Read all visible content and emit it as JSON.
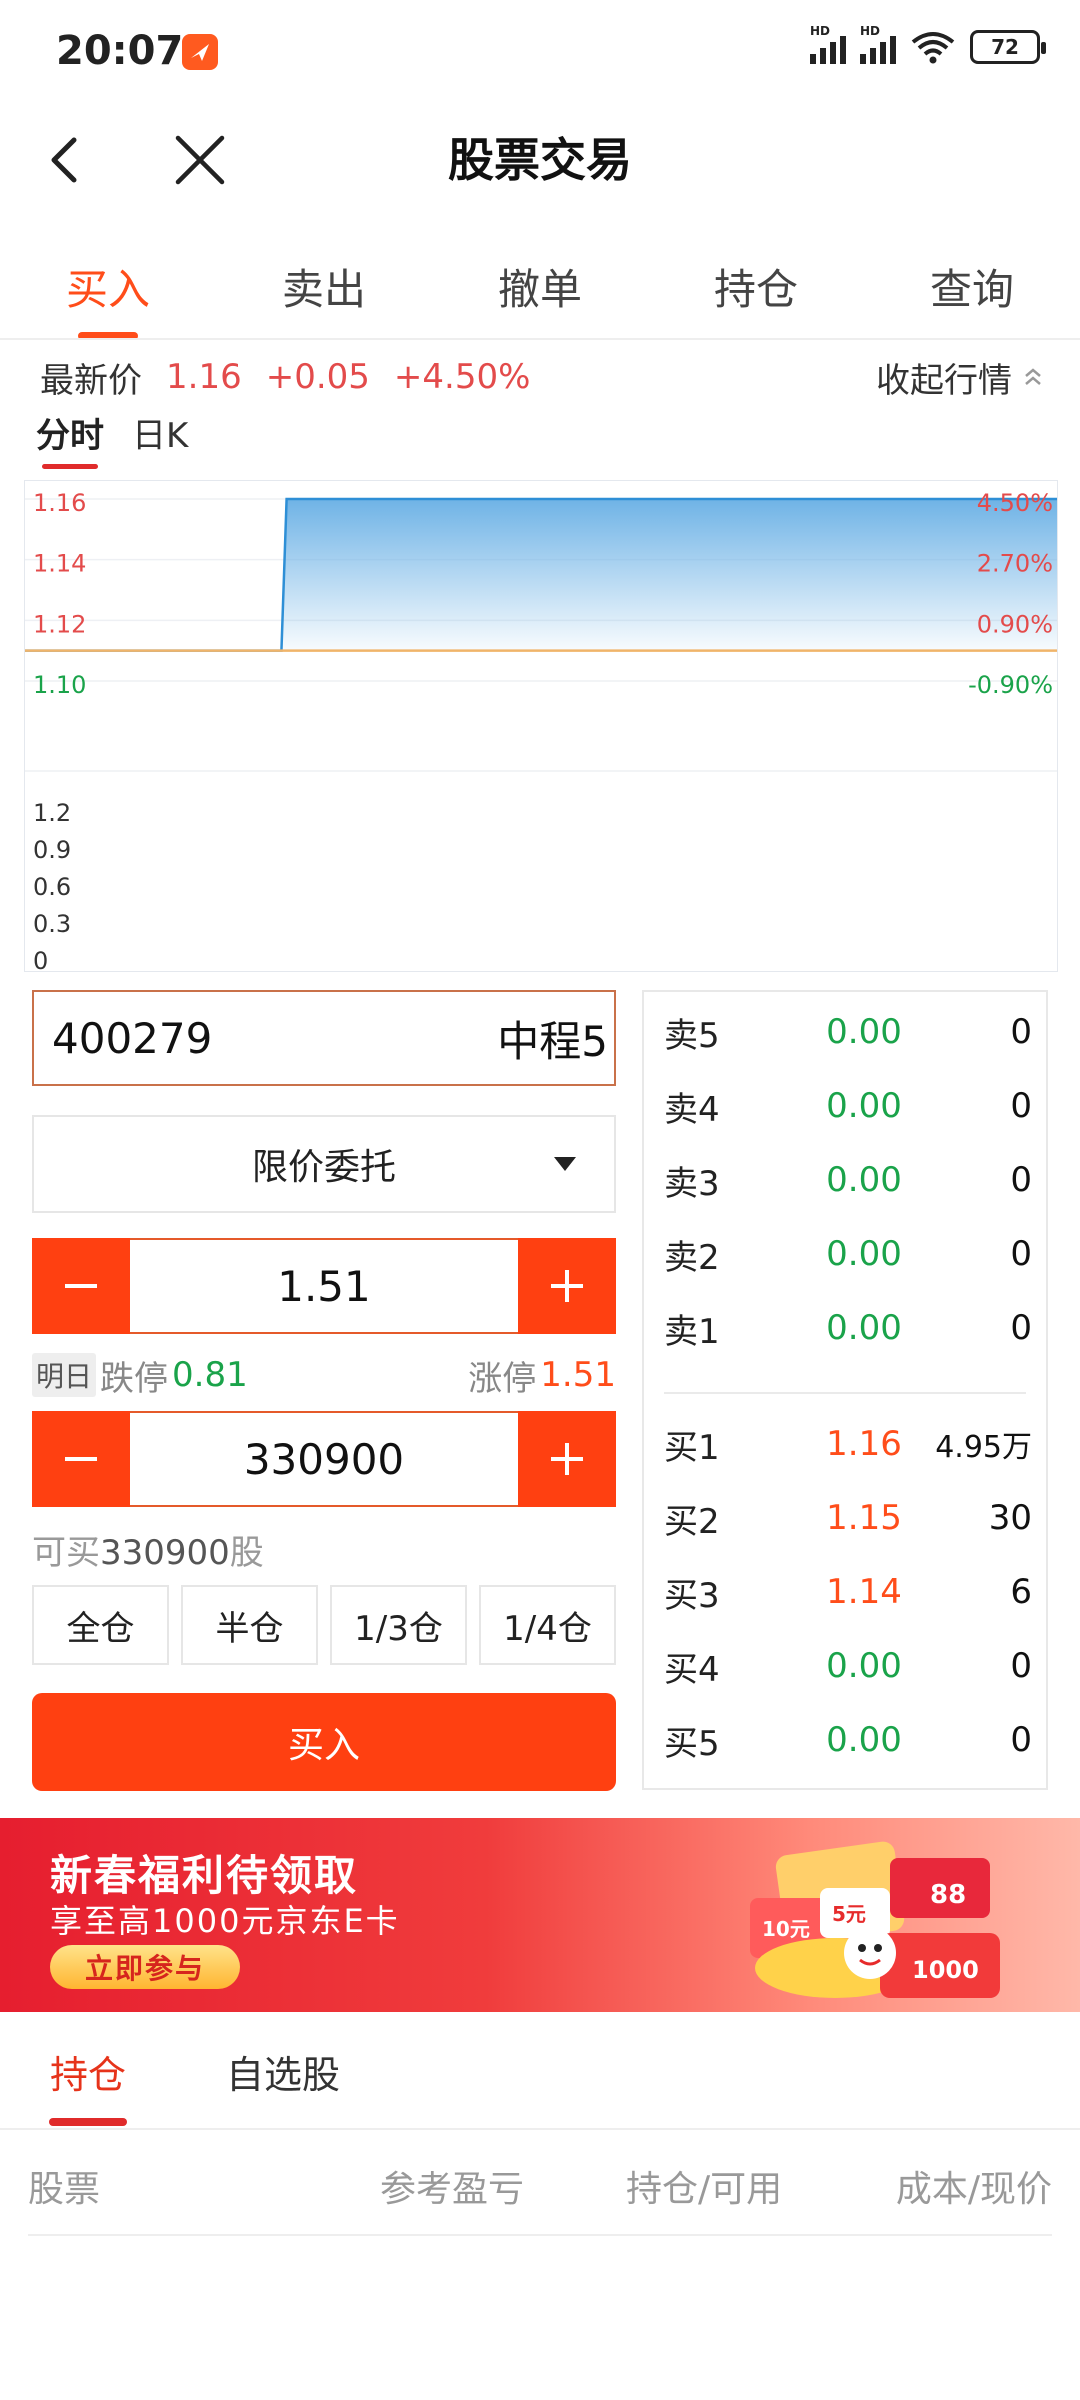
{
  "status_bar": {
    "time": "20:07",
    "signal1": "HD",
    "signal2": "HD",
    "battery": "72"
  },
  "nav": {
    "title": "股票交易"
  },
  "tabs": [
    {
      "label": "买入",
      "active": true
    },
    {
      "label": "卖出"
    },
    {
      "label": "撤单"
    },
    {
      "label": "持仓"
    },
    {
      "label": "查询"
    }
  ],
  "quote": {
    "label": "最新价",
    "price": "1.16",
    "change": "+0.05",
    "change_pct": "+4.50%",
    "collapse_label": "收起行情"
  },
  "chart_tabs": [
    {
      "label": "分时",
      "active": true
    },
    {
      "label": "日K"
    }
  ],
  "chart_data": {
    "type": "area",
    "price_ticks": [
      "1.16",
      "1.14",
      "1.12",
      "1.10"
    ],
    "pct_ticks": [
      "4.50%",
      "2.70%",
      "0.90%",
      "-0.90%"
    ],
    "volume_ticks": [
      "1.2",
      "0.9",
      "0.6",
      "0.3",
      "0"
    ],
    "ylim": [
      1.1,
      1.16
    ],
    "base_price": 1.11,
    "x": [
      0,
      0.248,
      0.253,
      1.0
    ],
    "y": [
      1.11,
      1.11,
      1.16,
      1.16
    ],
    "colors": {
      "fill_top": "#6fb3e6",
      "line": "#2e8fd6",
      "base": "#f0b46a"
    }
  },
  "trade": {
    "code": "400279",
    "name": "中程5",
    "order_type": "限价委托",
    "price": "1.51",
    "tomorrow_label": "明日",
    "limit_down_label": "跌停",
    "limit_down": "0.81",
    "limit_up_label": "涨停",
    "limit_up": "1.51",
    "quantity": "330900",
    "can_buy_prefix": "可买",
    "can_buy_qty": "330900",
    "can_buy_unit": "股",
    "position_buttons": [
      "全仓",
      "半仓",
      "1/3仓",
      "1/4仓"
    ],
    "buy_button": "买入"
  },
  "order_book": {
    "asks": [
      {
        "label": "卖5",
        "price": "0.00",
        "vol": "0"
      },
      {
        "label": "卖4",
        "price": "0.00",
        "vol": "0"
      },
      {
        "label": "卖3",
        "price": "0.00",
        "vol": "0"
      },
      {
        "label": "卖2",
        "price": "0.00",
        "vol": "0"
      },
      {
        "label": "卖1",
        "price": "0.00",
        "vol": "0"
      }
    ],
    "bids": [
      {
        "label": "买1",
        "price": "1.16",
        "vol": "4.95万"
      },
      {
        "label": "买2",
        "price": "1.15",
        "vol": "30"
      },
      {
        "label": "买3",
        "price": "1.14",
        "vol": "6"
      },
      {
        "label": "买4",
        "price": "0.00",
        "vol": "0"
      },
      {
        "label": "买5",
        "price": "0.00",
        "vol": "0"
      }
    ]
  },
  "banner": {
    "title": "新春福利待领取",
    "subtitle": "享至高1000元京东E卡",
    "cta": "立即参与",
    "art_labels": [
      "10元",
      "5元",
      "88",
      "1000"
    ]
  },
  "bottom_tabs": [
    {
      "label": "持仓",
      "active": true
    },
    {
      "label": "自选股"
    }
  ],
  "table_headers": [
    "股票",
    "参考盈亏",
    "持仓/可用",
    "成本/现价"
  ]
}
